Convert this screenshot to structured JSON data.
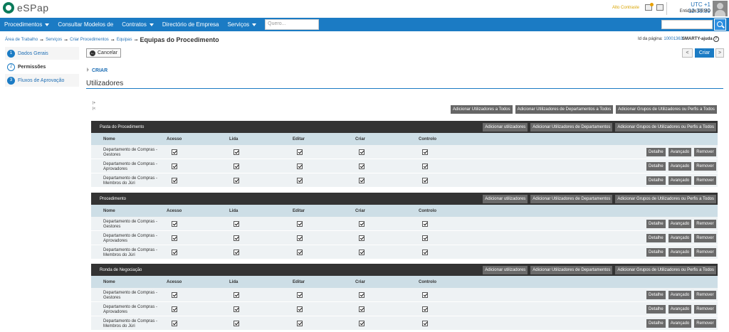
{
  "app": {
    "logo_text": "eSPap"
  },
  "topbar": {
    "alerts": "Alto Contraste",
    "clock": "UTC +1 12:30:39",
    "entity": "Entidade DEMO"
  },
  "nav": {
    "items": [
      {
        "label": "Procedimentos",
        "has_caret": true
      },
      {
        "label": "Consultar Modelos de",
        "has_caret": false
      },
      {
        "label": "Contratos",
        "has_caret": true
      },
      {
        "label": "Directório de Empresa",
        "has_caret": false
      },
      {
        "label": "Serviços",
        "has_caret": true
      }
    ],
    "quick_search_placeholder": "Quero..."
  },
  "breadcrumb": {
    "items": [
      "Área de Trabalho",
      "Serviços",
      "Criar Procedimentos",
      "Equipas"
    ],
    "current": "Equipas do Procedimento"
  },
  "page_id": {
    "label": "Id da página:",
    "value": "10001363"
  },
  "help": {
    "label": "SMARTY-ajuda",
    "icon": "?"
  },
  "steps": [
    {
      "num": "1",
      "label": "Dados Gerais"
    },
    {
      "num": "2",
      "label": "Permissões",
      "active": true
    },
    {
      "num": "3",
      "label": "Fluxos de Aprovação"
    }
  ],
  "toolbar": {
    "cancel_label": "Cancelar",
    "prev_label": "<",
    "criar_label": "Criar",
    "next_label": ">"
  },
  "section": {
    "sub": "CRIAR",
    "title": "Utilizadores",
    "marks": [
      "|+",
      "|<"
    ]
  },
  "top_actions": [
    "Adicionar Utilizadores a Todos",
    "Adicionar Utilizadores de Departamentos a Todos",
    "Adicionar Grupos de Utilizadores ou Perfis a Todos"
  ],
  "columns": [
    "Nome",
    "Acesso",
    "Lida",
    "Editar",
    "Criar",
    "Controlo"
  ],
  "group_buttons": [
    "Adicionar utilizadores",
    "Adicionar Utilizadores de Departamentos",
    "Adicionar Grupos de Utilizadores ou Perfis a Todos"
  ],
  "row_buttons": [
    "Detalhe",
    "Avançado",
    "Remover"
  ],
  "groups": [
    {
      "name": "Pasta do Procedimento",
      "rows": [
        {
          "name": "Departamento de Compras - Gestores",
          "checks": [
            true,
            true,
            true,
            true,
            true
          ]
        },
        {
          "name": "Departamento de Compras - Aprovadores",
          "checks": [
            true,
            true,
            true,
            true,
            true
          ]
        },
        {
          "name": "Departamento de Compras - Membros do Júri",
          "checks": [
            true,
            true,
            true,
            true,
            true
          ]
        }
      ]
    },
    {
      "name": "Procedimento",
      "rows": [
        {
          "name": "Departamento de Compras - Gestores",
          "checks": [
            true,
            true,
            true,
            true,
            true
          ]
        },
        {
          "name": "Departamento de Compras - Aprovadores",
          "checks": [
            true,
            true,
            true,
            true,
            true
          ]
        },
        {
          "name": "Departamento de Compras - Membros do Júri",
          "checks": [
            true,
            true,
            true,
            true,
            true
          ]
        }
      ]
    },
    {
      "name": "Ronda de Negociação",
      "rows": [
        {
          "name": "Departamento de Compras - Gestores",
          "checks": [
            true,
            true,
            true,
            true,
            true
          ]
        },
        {
          "name": "Departamento de Compras - Aprovadores",
          "checks": [
            true,
            true,
            true,
            true,
            true
          ]
        },
        {
          "name": "Departamento de Compras - Membros do Júri",
          "checks": [
            true,
            true,
            true,
            true,
            true
          ]
        }
      ]
    }
  ]
}
